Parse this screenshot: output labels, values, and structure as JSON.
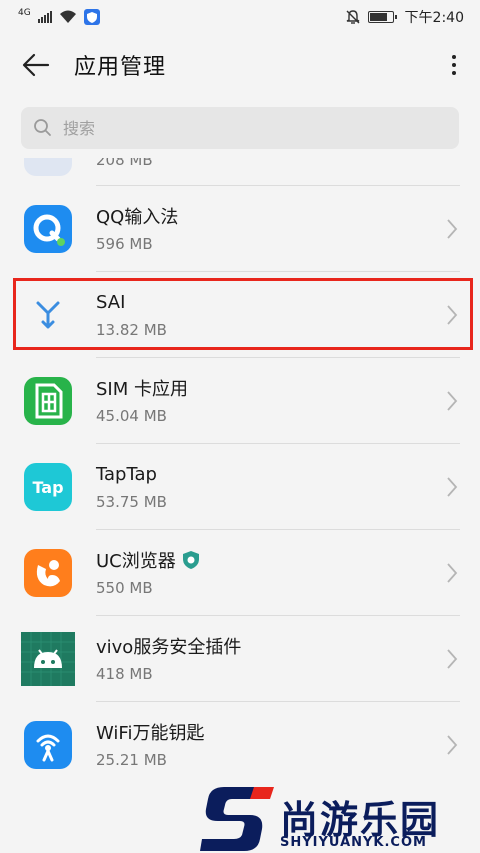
{
  "status_bar": {
    "network": "4G",
    "time": "下午2:40"
  },
  "app_bar": {
    "title": "应用管理"
  },
  "search": {
    "placeholder": "搜索"
  },
  "partial_item": {
    "size": "208 MB"
  },
  "apps": [
    {
      "name": "QQ输入法",
      "size": "596 MB",
      "icon": "qq-input-icon",
      "color": "#1e8cf0"
    },
    {
      "name": "SAI",
      "size": "13.82 MB",
      "icon": "sai-icon",
      "color": "#3b8de0",
      "highlighted": true
    },
    {
      "name": "SIM 卡应用",
      "size": "45.04 MB",
      "icon": "sim-card-icon",
      "color": "#28b34a"
    },
    {
      "name": "TapTap",
      "size": "53.75 MB",
      "icon": "taptap-icon",
      "color": "#1ec8d6"
    },
    {
      "name": "UC浏览器",
      "size": "550 MB",
      "icon": "uc-browser-icon",
      "color": "#ff7e1c",
      "badge": "shield-badge-icon"
    },
    {
      "name": "vivo服务安全插件",
      "size": "418 MB",
      "icon": "android-icon",
      "color": "#1f7a60"
    },
    {
      "name": "WiFi万能钥匙",
      "size": "25.21 MB",
      "icon": "wifi-key-icon",
      "color": "#1e8cf0"
    }
  ],
  "highlight_color": "#e8261c",
  "watermark": {
    "cn": "尚游乐园",
    "en": "SHYIYUANYK.COM"
  }
}
